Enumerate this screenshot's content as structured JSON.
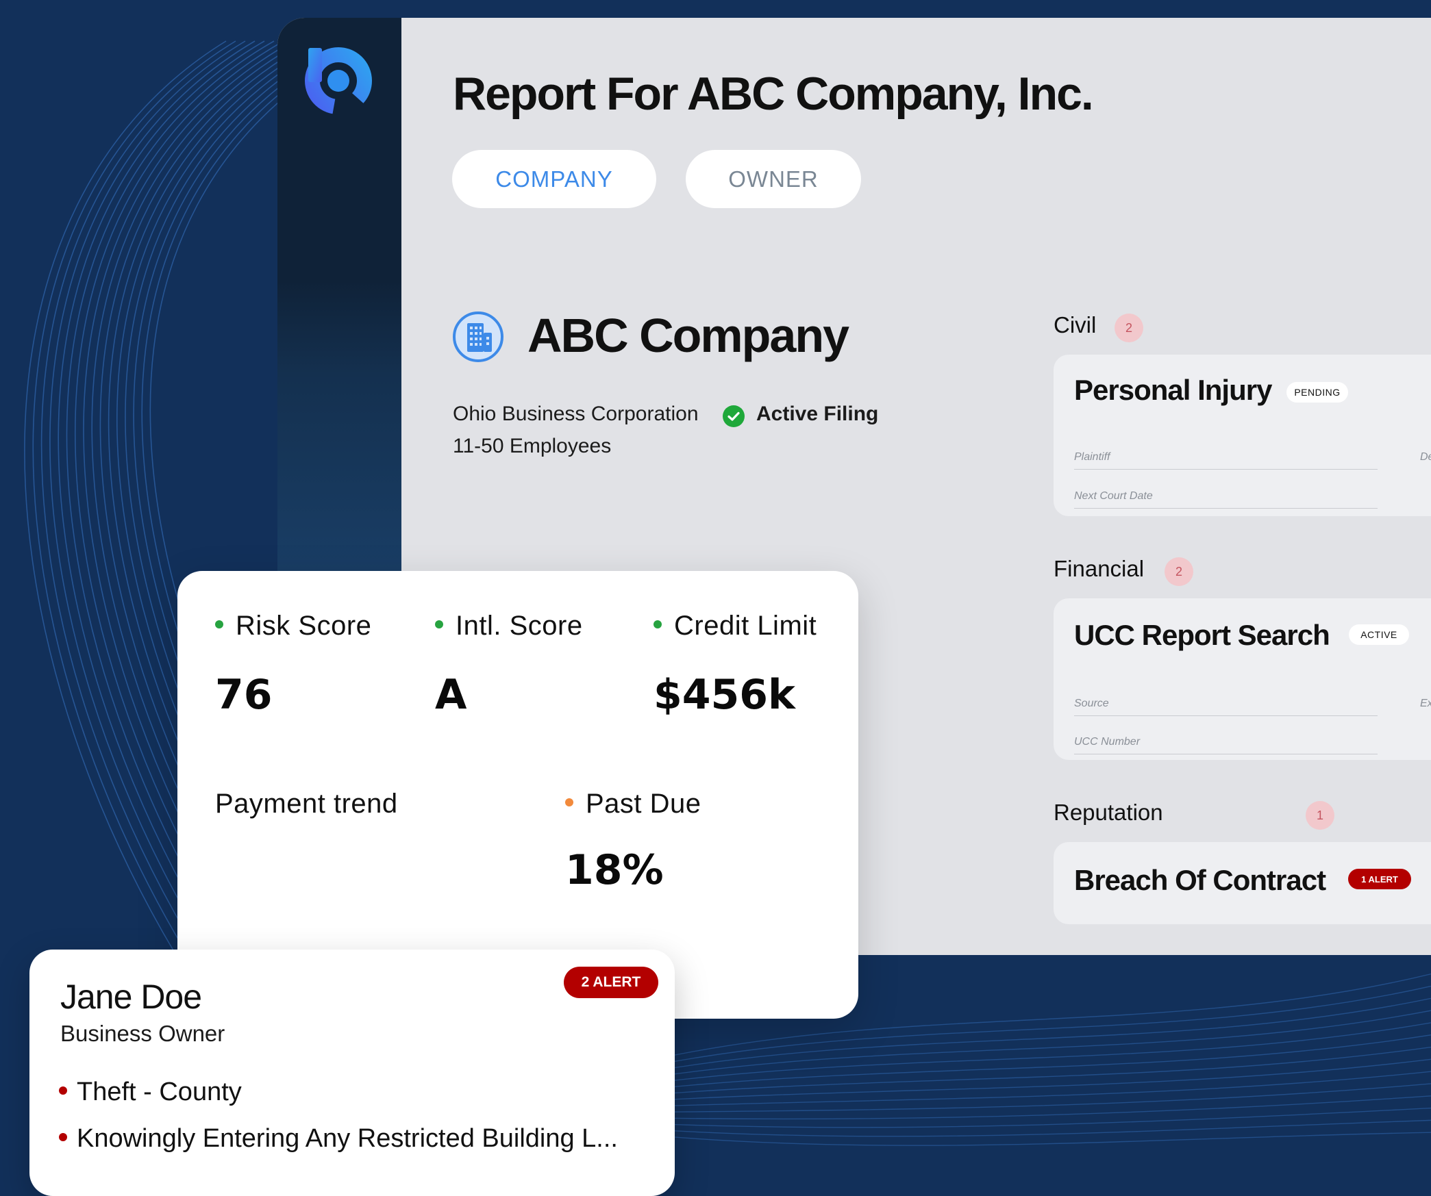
{
  "colors": {
    "background": "#12305a",
    "accent_blue": "#3d8ae8",
    "alert_red": "#b30000",
    "ok_green": "#27a340",
    "warn_orange": "#f28a3c"
  },
  "sidebar": {
    "logo_icon": "brand-b-logo-icon"
  },
  "report": {
    "title": "Report For ABC Company, Inc.",
    "tabs": [
      {
        "label": "COMPANY",
        "active": true
      },
      {
        "label": "OWNER",
        "active": false
      }
    ]
  },
  "company": {
    "icon": "building-icon",
    "name": "ABC Company",
    "type": "Ohio Business Corporation",
    "filing_status": "Active Filing",
    "filing_icon": "check-circle-icon",
    "employees": "11-50 Employees"
  },
  "sections": [
    {
      "label": "Civil",
      "count": "2",
      "card": {
        "title": "Personal Injury",
        "status": "PENDING",
        "fields": [
          "Plaintiff",
          "Next Court Date"
        ],
        "right_fields": [
          "De"
        ]
      }
    },
    {
      "label": "Financial",
      "count": "2",
      "card": {
        "title": "UCC Report Search",
        "status": "ACTIVE",
        "fields": [
          "Source",
          "UCC Number"
        ],
        "right_fields": [
          "Ex"
        ]
      }
    },
    {
      "label": "Reputation",
      "count": "1",
      "card": {
        "title": "Breach Of Contract",
        "status": "1 ALERT"
      }
    }
  ],
  "scores": {
    "metrics": [
      {
        "label": "Risk Score",
        "value": "76"
      },
      {
        "label": "Intl. Score",
        "value": "A"
      },
      {
        "label": "Credit Limit",
        "value": "$456k"
      }
    ],
    "payment_trend_label": "Payment trend",
    "past_due_label": "Past Due",
    "past_due_value": "18%"
  },
  "owner": {
    "name": "Jane Doe",
    "role": "Business Owner",
    "alert": "2 ALERT",
    "items": [
      "Theft - County",
      "Knowingly Entering Any Restricted Building L..."
    ]
  }
}
